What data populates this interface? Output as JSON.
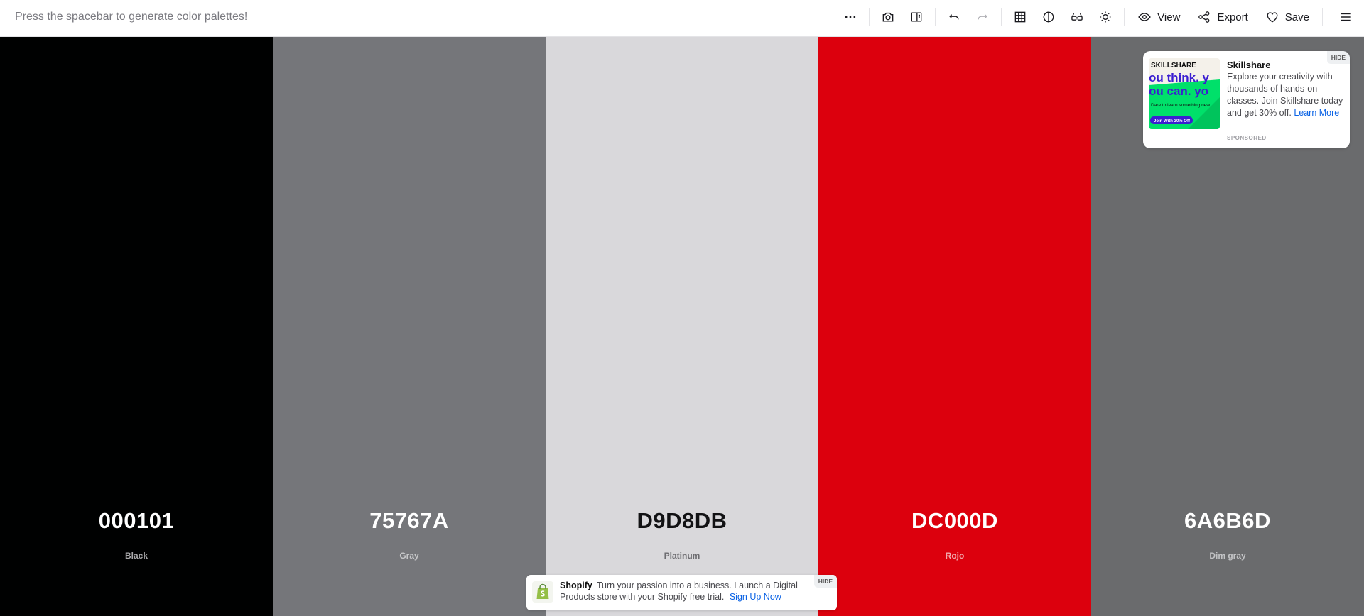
{
  "topbar": {
    "hint": "Press the spacebar to generate color palettes!",
    "view_label": "View",
    "export_label": "Export",
    "save_label": "Save"
  },
  "palette": [
    {
      "hex": "000101",
      "name": "Black",
      "bg": "#000101",
      "fg": "#ffffff",
      "sub": "#a9a9ab"
    },
    {
      "hex": "75767A",
      "name": "Gray",
      "bg": "#75767A",
      "fg": "#ffffff",
      "sub": "#c7c8ca"
    },
    {
      "hex": "D9D8DB",
      "name": "Platinum",
      "bg": "#D9D8DB",
      "fg": "#121214",
      "sub": "#6d6c70"
    },
    {
      "hex": "DC000D",
      "name": "Rojo",
      "bg": "#DC000D",
      "fg": "#ffffff",
      "sub": "#f1a9ad"
    },
    {
      "hex": "6A6B6D",
      "name": "Dim gray",
      "bg": "#6A6B6D",
      "fg": "#ffffff",
      "sub": "#c2c3c5"
    }
  ],
  "ad": {
    "brand": "Skillshare",
    "description": "Explore your creativity with thousands of hands-on classes. Join Skillshare today and get 30% off.",
    "link": "Learn More",
    "sponsored": "SPONSORED",
    "hide": "HIDE",
    "thumb_wordmark": "SKILLSHARE",
    "thumb_line1": "ou think. y",
    "thumb_line2": "ou can. yo",
    "thumb_small": "Dare to learn something new.",
    "thumb_cta": "Join With 30% Off"
  },
  "banner": {
    "brand": "Shopify",
    "text": "Turn your passion into a business. Launch a Digital Products store with your Shopify free trial.",
    "link": "Sign Up Now",
    "hide": "HIDE"
  }
}
